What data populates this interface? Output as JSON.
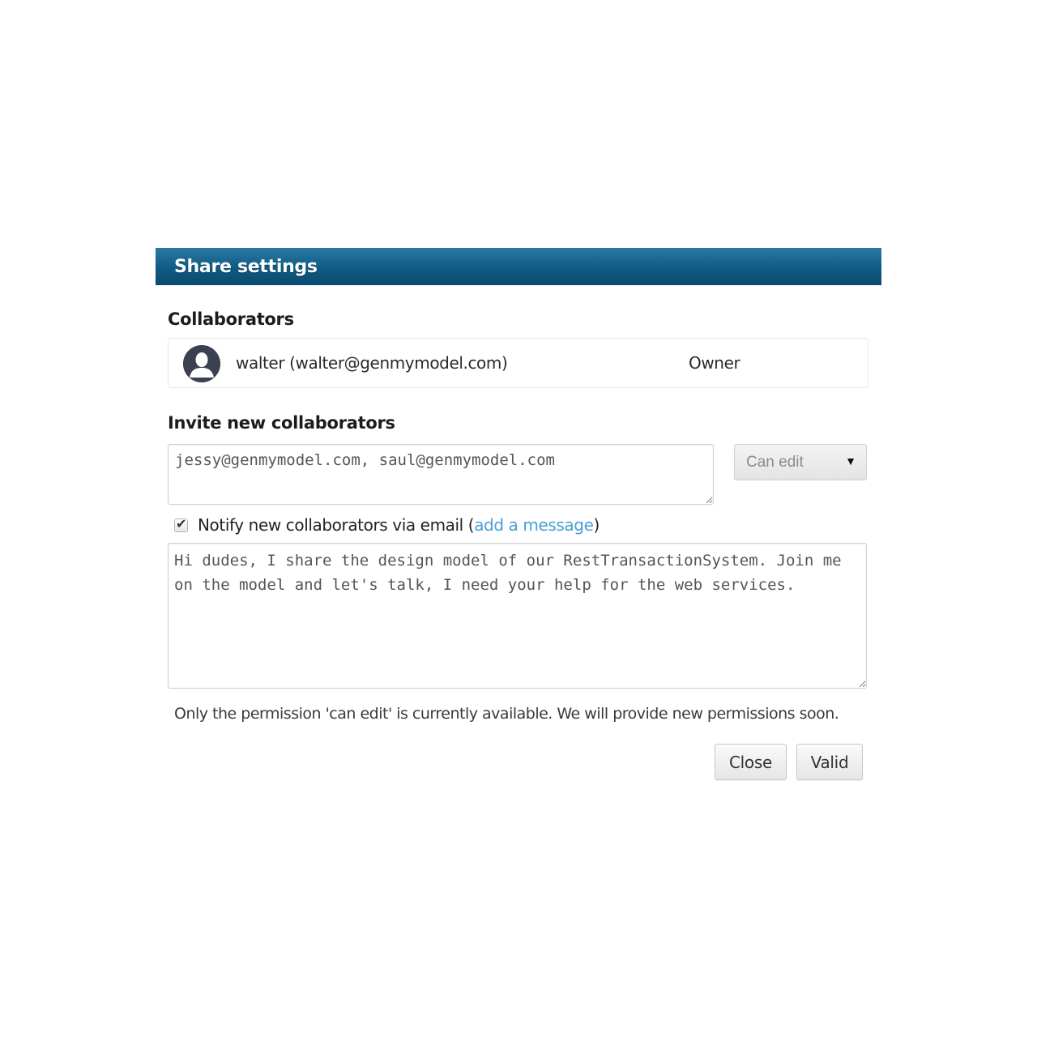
{
  "dialog": {
    "title": "Share settings"
  },
  "collaborators": {
    "heading": "Collaborators",
    "items": [
      {
        "name": "walter (walter@genmymodel.com)",
        "role": "Owner",
        "avatar_icon": "user-avatar-icon"
      }
    ]
  },
  "invite": {
    "heading": "Invite new collaborators",
    "emails_value": "jessy@genmymodel.com, saul@genmymodel.com",
    "permission_selected": "Can edit",
    "notify_label": "Notify new collaborators via email (",
    "notify_link": "add a message",
    "notify_suffix": ")",
    "notify_checked": true,
    "message_value": "Hi dudes, I share the design model of our RestTransactionSystem. Join me on the model and let's talk, I need your help for the web services."
  },
  "info": {
    "text": "Only the permission 'can edit' is currently available. We will provide new permissions soon."
  },
  "buttons": {
    "close_label": "Close",
    "valid_label": "Valid"
  },
  "colors": {
    "header": "#0f5a83",
    "link": "#4a9fd8"
  }
}
